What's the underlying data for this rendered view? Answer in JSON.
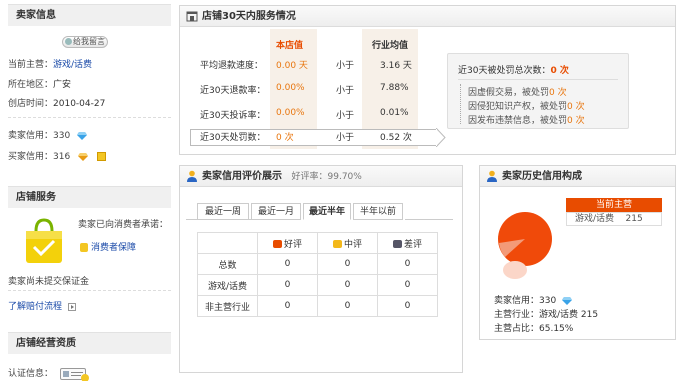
{
  "seller_info": {
    "heading": "卖家信息",
    "message_button": "给我留言",
    "rows": [
      {
        "label": "当前主营：",
        "value": "游戏/话费"
      },
      {
        "label": "所在地区：",
        "value": "广安"
      },
      {
        "label": "创店时间：",
        "value": "2010-04-27"
      }
    ],
    "seller_credit_label": "卖家信用：",
    "seller_credit_value": "330",
    "buyer_credit_label": "买家信用：",
    "buyer_credit_value": "316"
  },
  "shop_service": {
    "heading": "店铺服务",
    "promise": "卖家已向消费者承诺：",
    "guarantee": "消费者保障",
    "deposit_note": "卖家尚未提交保证金",
    "flow_link": "了解赔付流程"
  },
  "shop_qualification": {
    "heading": "店铺经营资质",
    "cert_label": "认证信息："
  },
  "service_panel": {
    "title": "店铺30天内服务情况",
    "col_store": "本店值",
    "col_industry": "行业均值",
    "rows": [
      {
        "label": "平均退款速度：",
        "store": "0.00 天",
        "cmp": "小于",
        "industry": "3.16 天"
      },
      {
        "label": "近30天退款率：",
        "store": "0.00%",
        "cmp": "小于",
        "industry": "7.88%"
      },
      {
        "label": "近30天投诉率：",
        "store": "0.00%",
        "cmp": "小于",
        "industry": "0.01%"
      },
      {
        "label": "近30天处罚数：",
        "store": "0 次",
        "cmp": "小于",
        "industry": "0.52 次"
      }
    ],
    "penalty_title": "近30天被处罚总次数：",
    "penalty_total": "0 次",
    "penalty_rows": [
      {
        "text": "因虚假交易，被处罚",
        "count": "0 次"
      },
      {
        "text": "因侵犯知识产权，被处罚",
        "count": "0 次"
      },
      {
        "text": "因发布违禁信息，被处罚",
        "count": "0 次"
      }
    ]
  },
  "rating_panel": {
    "title": "卖家信用评价展示",
    "rate_label": "好评率：",
    "rate_value": "99.70%",
    "tabs": [
      "最近一周",
      "最近一月",
      "最近半年",
      "半年以前"
    ],
    "active_tab": "最近半年",
    "headers": [
      "好评",
      "中评",
      "差评"
    ],
    "rows": [
      {
        "label": "总数",
        "values": [
          "0",
          "0",
          "0"
        ]
      },
      {
        "label": "游戏/话费",
        "values": [
          "0",
          "0",
          "0"
        ]
      },
      {
        "label": "非主营行业",
        "values": [
          "0",
          "0",
          "0"
        ]
      }
    ]
  },
  "history_panel": {
    "title": "卖家历史信用构成",
    "badge": "当前主营",
    "category": "游戏/话费",
    "category_count": "215",
    "seller_credit_label": "卖家信用：",
    "seller_credit_value": "330",
    "main_industry": "主营行业：游戏/话费  215",
    "main_share": "主营占比：65.15%"
  },
  "colors": {
    "accent": "#e84c00",
    "store_col_bg": "#f7f0e8",
    "pie": "#f04a0a"
  }
}
